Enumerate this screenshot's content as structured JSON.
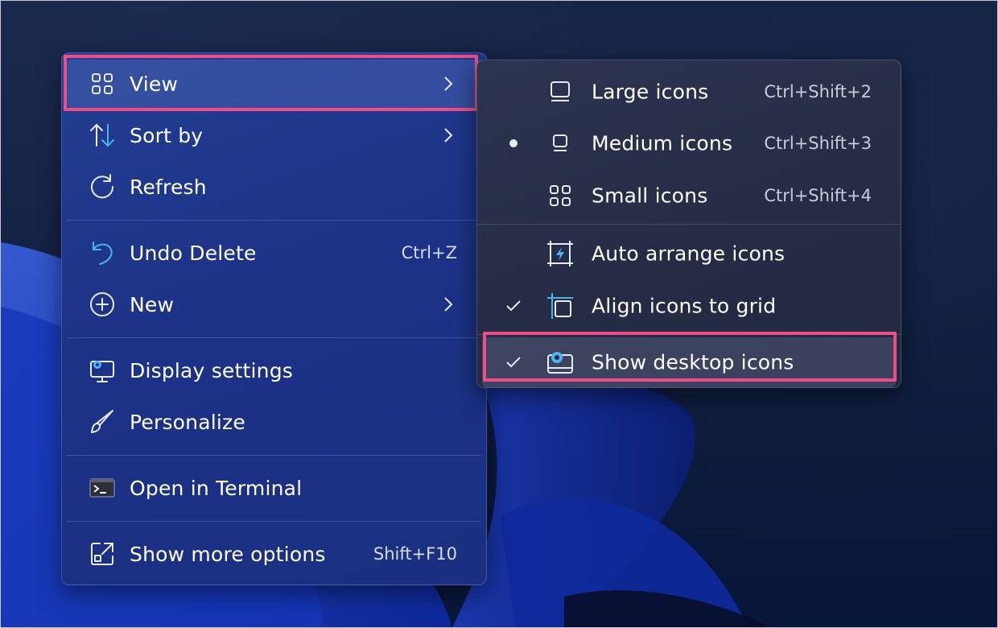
{
  "menu": {
    "items": [
      {
        "label": "View",
        "icon": "grid-icon",
        "has_submenu": true,
        "highlighted": true
      },
      {
        "label": "Sort by",
        "icon": "sort-icon",
        "has_submenu": true
      },
      {
        "label": "Refresh",
        "icon": "refresh-icon"
      },
      {
        "label": "Undo Delete",
        "icon": "undo-icon",
        "shortcut": "Ctrl+Z"
      },
      {
        "label": "New",
        "icon": "new-plus-icon",
        "has_submenu": true
      },
      {
        "label": "Display settings",
        "icon": "display-settings-icon"
      },
      {
        "label": "Personalize",
        "icon": "brush-icon"
      },
      {
        "label": "Open in Terminal",
        "icon": "terminal-icon"
      },
      {
        "label": "Show more options",
        "icon": "external-open-icon",
        "shortcut": "Shift+F10"
      }
    ]
  },
  "submenu": {
    "items": [
      {
        "label": "Large icons",
        "icon": "large-icons-icon",
        "shortcut": "Ctrl+Shift+2",
        "state": "none"
      },
      {
        "label": "Medium icons",
        "icon": "medium-icons-icon",
        "shortcut": "Ctrl+Shift+3",
        "state": "selected-dot"
      },
      {
        "label": "Small icons",
        "icon": "small-icons-icon",
        "shortcut": "Ctrl+Shift+4",
        "state": "none"
      },
      {
        "label": "Auto arrange icons",
        "icon": "auto-arrange-icon",
        "state": "none"
      },
      {
        "label": "Align icons to grid",
        "icon": "align-grid-icon",
        "state": "checked"
      },
      {
        "label": "Show desktop icons",
        "icon": "show-desktop-icon",
        "state": "checked",
        "highlighted": true
      }
    ]
  },
  "colors": {
    "highlight": "#ee4d86",
    "menu_bg": "#1c3287",
    "submenu_bg": "#262c45",
    "accent_icon": "#4fb3f0"
  }
}
